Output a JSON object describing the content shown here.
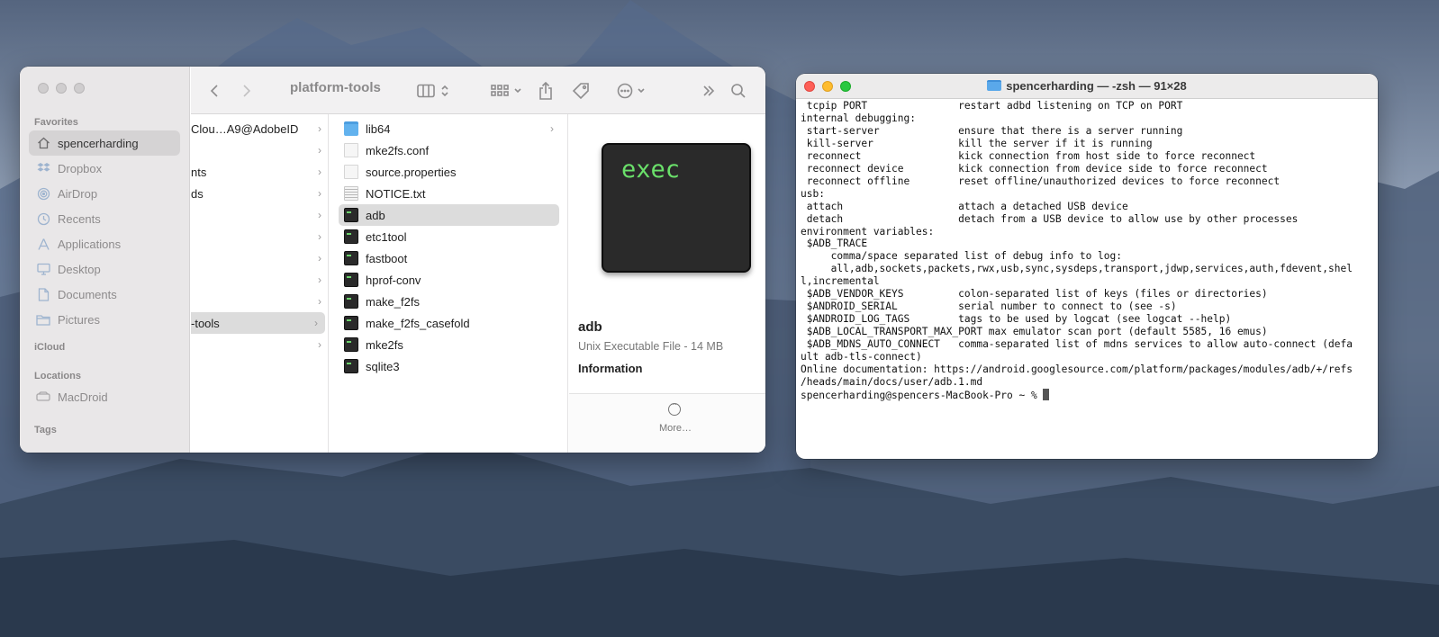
{
  "finder": {
    "title": "platform-tools",
    "sidebar": {
      "favorites_header": "Favorites",
      "favorites": [
        {
          "label": "spencerharding",
          "icon": "home-icon",
          "selected": true
        },
        {
          "label": "Dropbox",
          "icon": "dropbox-icon"
        },
        {
          "label": "AirDrop",
          "icon": "airdrop-icon"
        },
        {
          "label": "Recents",
          "icon": "clock-icon"
        },
        {
          "label": "Applications",
          "icon": "applications-icon"
        },
        {
          "label": "Desktop",
          "icon": "desktop-icon"
        },
        {
          "label": "Documents",
          "icon": "document-icon"
        },
        {
          "label": "Pictures",
          "icon": "folder-icon"
        }
      ],
      "icloud_header": "iCloud",
      "locations_header": "Locations",
      "locations": [
        {
          "label": "MacDroid",
          "icon": "drive-icon"
        }
      ],
      "tags_header": "Tags"
    },
    "column1": [
      {
        "label": "Clou…A9@AdobeID"
      },
      {
        "label": ""
      },
      {
        "label": "nts"
      },
      {
        "label": "ds"
      },
      {
        "label": ""
      },
      {
        "label": ""
      },
      {
        "label": ""
      },
      {
        "label": ""
      },
      {
        "label": ""
      },
      {
        "label": "-tools",
        "selected": true
      },
      {
        "label": ""
      }
    ],
    "column2": [
      {
        "label": "lib64",
        "icon": "folder",
        "has_children": true
      },
      {
        "label": "mke2fs.conf",
        "icon": "doc"
      },
      {
        "label": "source.properties",
        "icon": "doc"
      },
      {
        "label": "NOTICE.txt",
        "icon": "txt"
      },
      {
        "label": "adb",
        "icon": "exec",
        "selected": true
      },
      {
        "label": "etc1tool",
        "icon": "exec"
      },
      {
        "label": "fastboot",
        "icon": "exec"
      },
      {
        "label": "hprof-conv",
        "icon": "exec"
      },
      {
        "label": "make_f2fs",
        "icon": "exec"
      },
      {
        "label": "make_f2fs_casefold",
        "icon": "exec"
      },
      {
        "label": "mke2fs",
        "icon": "exec"
      },
      {
        "label": "sqlite3",
        "icon": "exec"
      }
    ],
    "preview": {
      "icon_text": "exec",
      "name": "adb",
      "kind": "Unix Executable File - 14 MB",
      "info_header": "Information",
      "more_label": "More…"
    }
  },
  "terminal": {
    "title": "spencerharding — -zsh — 91×28",
    "lines": [
      " tcpip PORT               restart adbd listening on TCP on PORT",
      "",
      "internal debugging:",
      " start-server             ensure that there is a server running",
      " kill-server              kill the server if it is running",
      " reconnect                kick connection from host side to force reconnect",
      " reconnect device         kick connection from device side to force reconnect",
      " reconnect offline        reset offline/unauthorized devices to force reconnect",
      "",
      "usb:",
      " attach                   attach a detached USB device",
      " detach                   detach from a USB device to allow use by other processes",
      "environment variables:",
      " $ADB_TRACE",
      "     comma/space separated list of debug info to log:",
      "     all,adb,sockets,packets,rwx,usb,sync,sysdeps,transport,jdwp,services,auth,fdevent,shel",
      "l,incremental",
      " $ADB_VENDOR_KEYS         colon-separated list of keys (files or directories)",
      " $ANDROID_SERIAL          serial number to connect to (see -s)",
      " $ANDROID_LOG_TAGS        tags to be used by logcat (see logcat --help)",
      " $ADB_LOCAL_TRANSPORT_MAX_PORT max emulator scan port (default 5585, 16 emus)",
      " $ADB_MDNS_AUTO_CONNECT   comma-separated list of mdns services to allow auto-connect (defa",
      "ult adb-tls-connect)",
      "",
      "Online documentation: https://android.googlesource.com/platform/packages/modules/adb/+/refs",
      "/heads/main/docs/user/adb.1.md",
      ""
    ],
    "prompt": "spencerharding@spencers-MacBook-Pro ~ % "
  }
}
